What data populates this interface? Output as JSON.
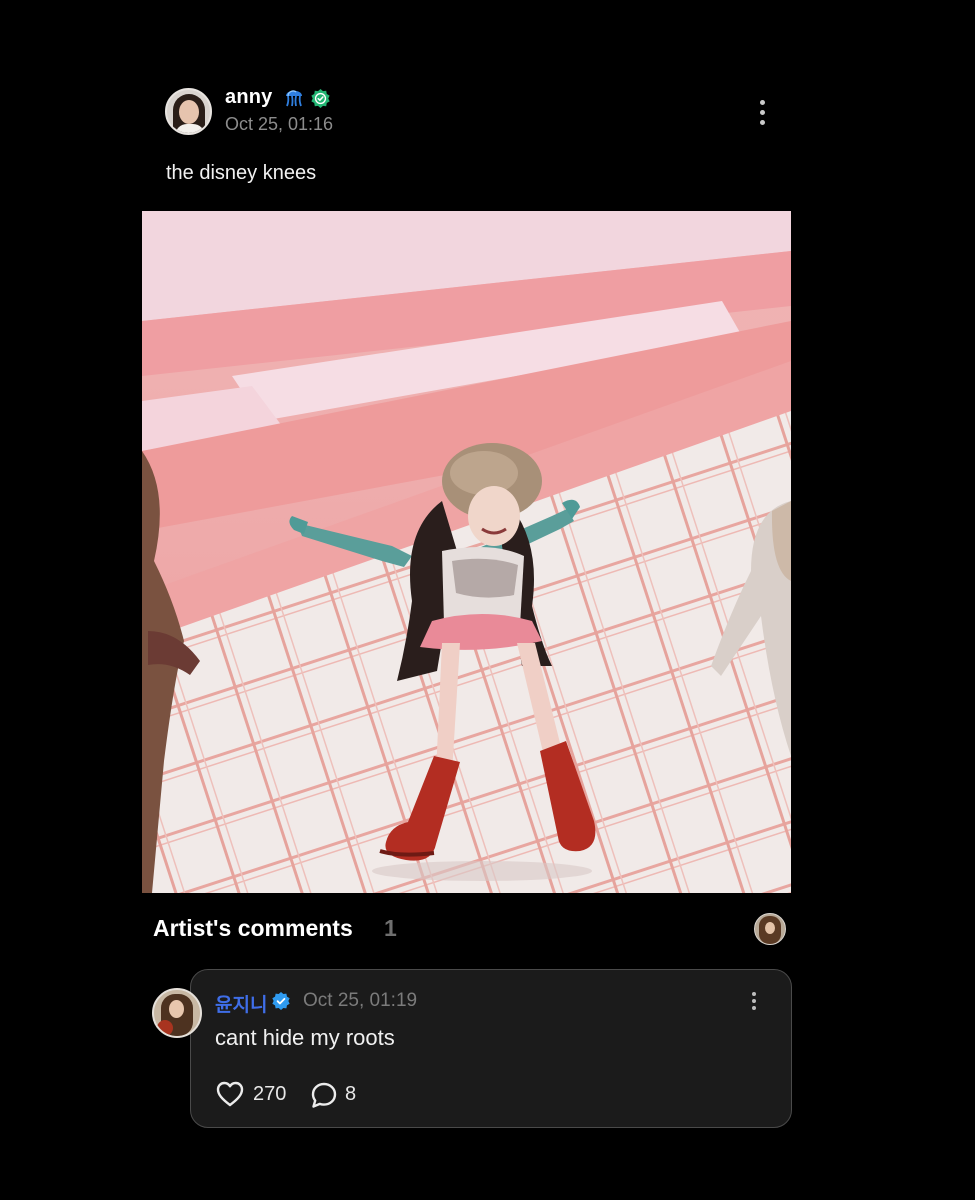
{
  "post": {
    "username": "anny",
    "date": "Oct 25, 01:16",
    "text": "the disney knees"
  },
  "artist_comments": {
    "title": "Artist's comments",
    "count": "1"
  },
  "comment": {
    "author": "윤지니",
    "date": "Oct 25, 01:19",
    "text": "cant hide my roots",
    "likes": "270",
    "replies": "8"
  },
  "icons": {
    "verified": "verified-check-icon",
    "jellyfish": "jellyfish-emoji-icon",
    "more": "more-vertical-icon",
    "like": "heart-icon",
    "reply": "speech-bubble-icon"
  },
  "colors": {
    "background": "#000000",
    "card": "#1b1b1b",
    "author_blue": "#3f6ee8",
    "verified_green": "#22b573",
    "verified_blue": "#2f9bf0",
    "muted": "#8c8c8c"
  }
}
